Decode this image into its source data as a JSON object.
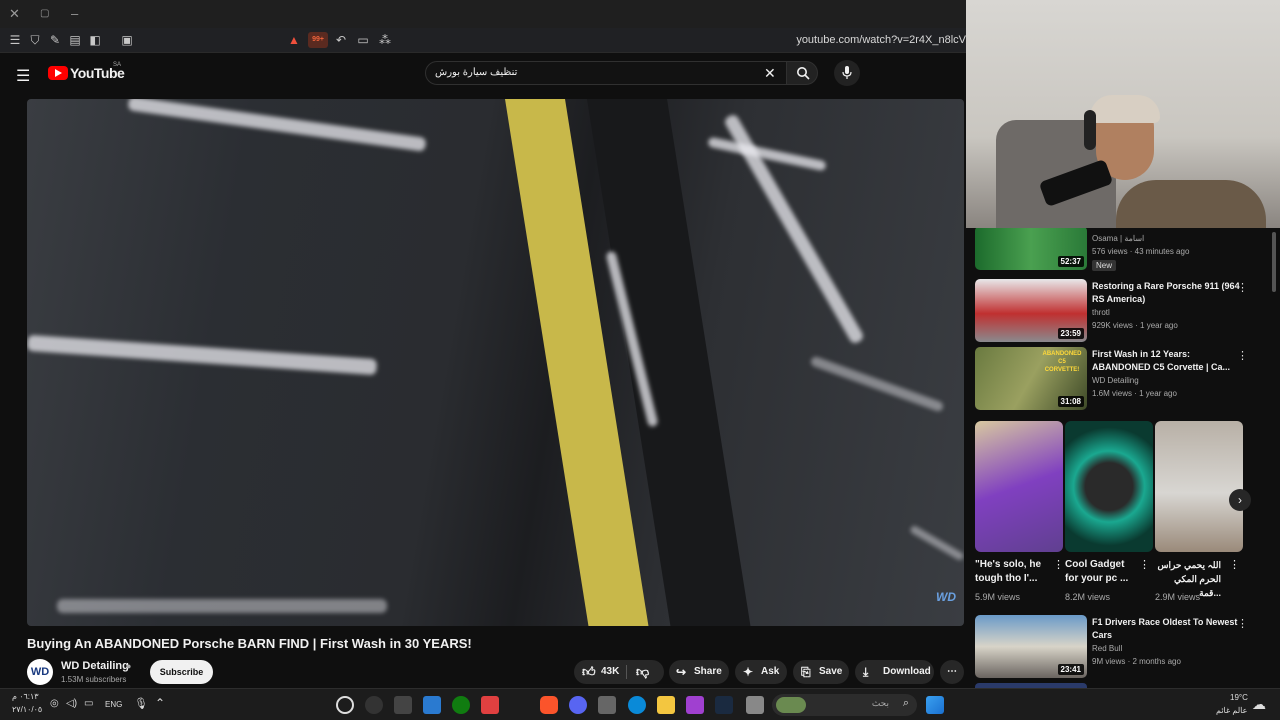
{
  "browser": {
    "url": "youtube.com/watch?v=2r4X_n8lcV",
    "shield_badge": "99+"
  },
  "youtube": {
    "logo_text": "YouTube",
    "region": "SA",
    "search_value": "تنظيف سيارة بورش"
  },
  "video": {
    "watermark": "WD",
    "title": "Buying An ABANDONED Porsche BARN FIND | First Wash in 30 YEARS!",
    "channel": "WD Detailing",
    "subscribers": "1.53M subscribers",
    "subscribe_label": "Subscribe",
    "likes": "43K",
    "share_label": "Share",
    "ask_label": "Ask",
    "save_label": "Save",
    "download_label": "Download"
  },
  "sidebar": {
    "videos": [
      {
        "title": "",
        "channel": "Osama | اسامة",
        "meta": "576 views · 43 minutes ago",
        "duration": "52:37",
        "badge": "New"
      },
      {
        "title": "Restoring a Rare Porsche 911 (964 RS America)",
        "channel": "throtl",
        "meta": "929K views · 1 year ago",
        "duration": "23:59"
      },
      {
        "title": "First Wash in 12 Years: ABANDONED C5 Corvette | Ca...",
        "channel": "WD Detailing",
        "meta": "1.6M views · 1 year ago",
        "duration": "31:08",
        "thumb_text": "ABANDONED C5 CORVETTE!"
      },
      {
        "title": "F1 Drivers Race Oldest To Newest Cars",
        "channel": "Red Bull",
        "meta": "9M views · 2 months ago",
        "duration": "23:41"
      }
    ],
    "shorts": [
      {
        "title": "\"He's solo, he tough tho I'...",
        "views": "5.9M views"
      },
      {
        "title": "Cool Gadget for your pc ...",
        "views": "8.2M views"
      },
      {
        "title": "اللہ يحمي حراس الحرم المكي قمة...",
        "views": "2.9M views"
      }
    ]
  },
  "taskbar": {
    "time": "٠٦:١٣ م",
    "date": "٢٧/١٠/٠٥",
    "lang": "ENG",
    "search_placeholder": "بحث",
    "temp": "19°C",
    "weather": "عالم غائم"
  },
  "colors": {
    "yt_red": "#ff0000",
    "bg": "#0f0f0f",
    "pill": "#272727"
  }
}
